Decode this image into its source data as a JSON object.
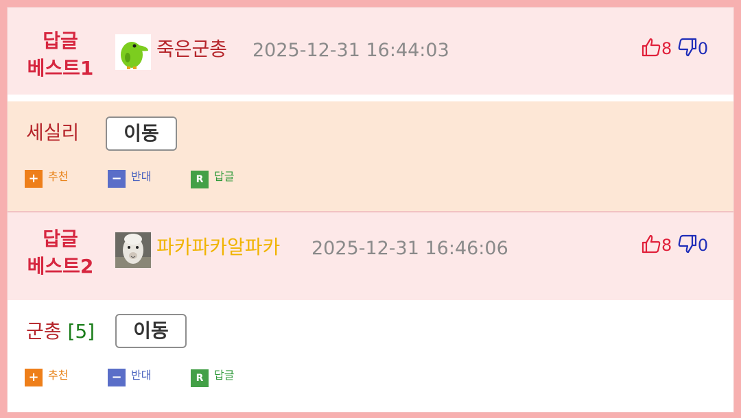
{
  "comments": [
    {
      "best_label_line1": "답글",
      "best_label_line2": "베스트1",
      "nickname": "죽은군총",
      "nickname_color": "#b5242a",
      "timestamp": "2025-12-31 16:44:03",
      "upvotes": "8",
      "downvotes": "0",
      "text": "세실리",
      "reply_count": "",
      "move_button_label": "이동",
      "avatar_icon": "green-parrot-icon",
      "background": "#fde7d6"
    },
    {
      "best_label_line1": "답글",
      "best_label_line2": "베스트2",
      "nickname": "파카파카알파카",
      "nickname_color": "#f0b400",
      "timestamp": "2025-12-31 16:46:06",
      "upvotes": "8",
      "downvotes": "0",
      "text": "군총",
      "reply_count": "[5]",
      "move_button_label": "이동",
      "avatar_icon": "alpaca-photo-icon",
      "background": "#ffffff"
    }
  ],
  "actions": {
    "recommend_label": "추천",
    "oppose_label": "반대",
    "reply_label": "답글"
  },
  "colors": {
    "frame": "#f7b0b0",
    "header_bg": "#fde8e8",
    "best_label": "#d6263f",
    "upvote": "#e0203a",
    "downvote": "#1f2db8"
  }
}
